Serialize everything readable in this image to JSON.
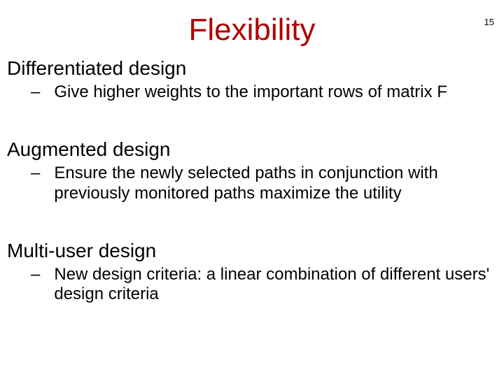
{
  "page_number": "15",
  "title": "Flexibility",
  "sections": [
    {
      "heading": "Differentiated design",
      "bullet": "Give higher weights to the important rows of matrix F"
    },
    {
      "heading": "Augmented design",
      "bullet": "Ensure the newly selected paths in conjunction with previously monitored paths maximize the utility"
    },
    {
      "heading": "Multi-user design",
      "bullet": "New design criteria: a linear combination of different users' design criteria"
    }
  ],
  "bullet_marker": "–"
}
